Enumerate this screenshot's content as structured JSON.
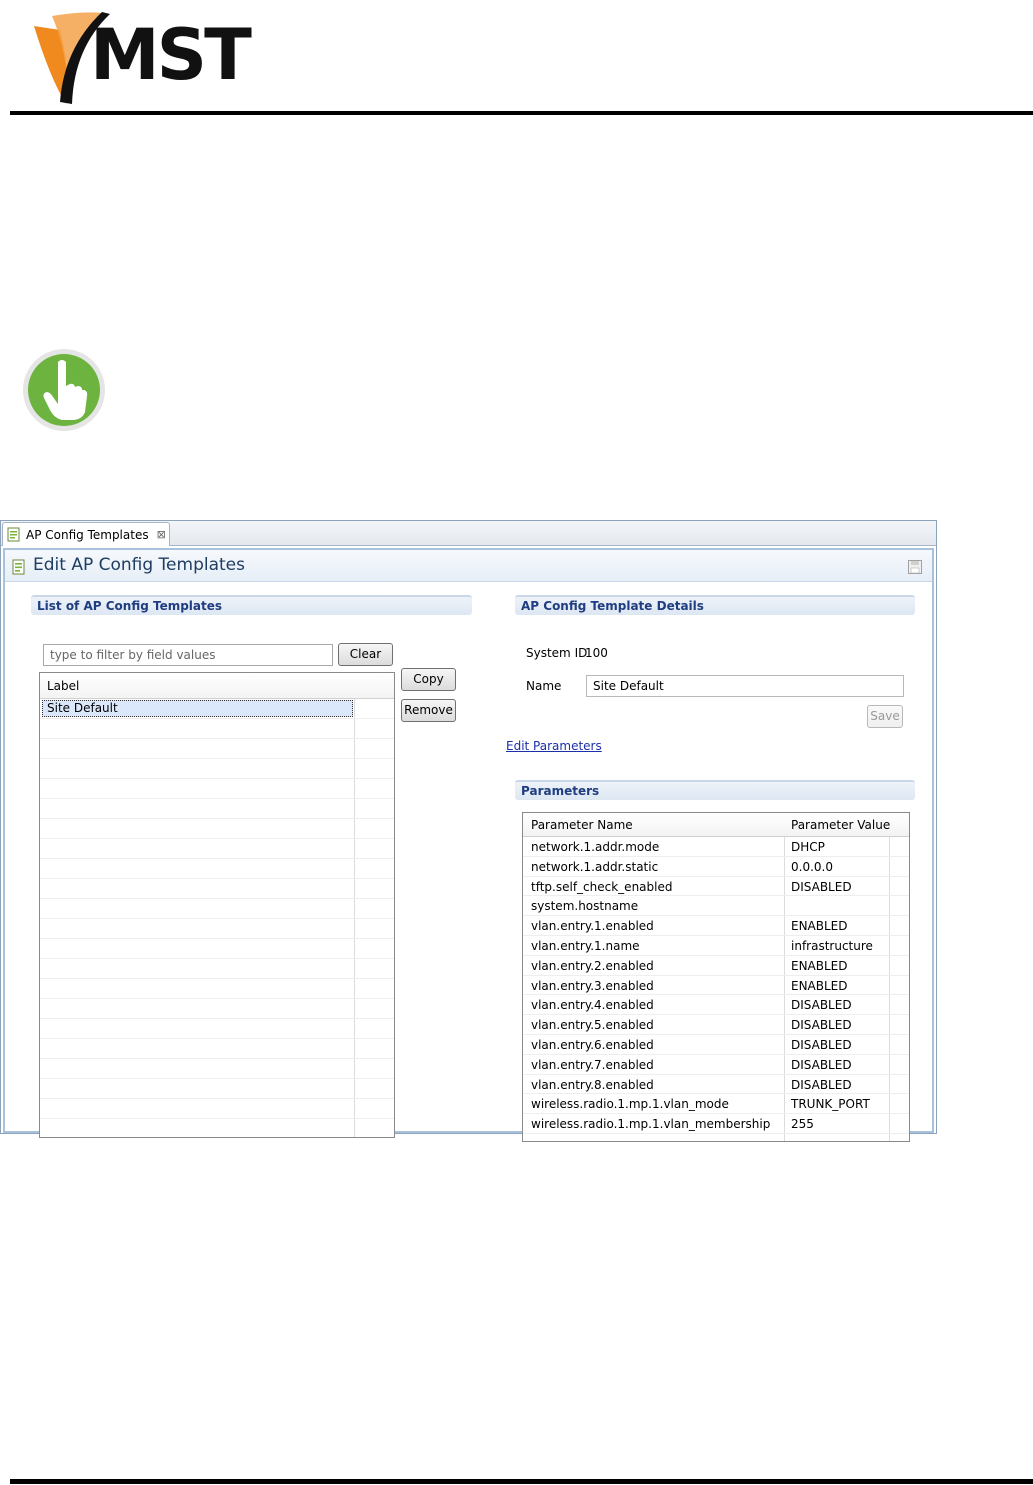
{
  "brand": {
    "logo_text": "MST",
    "accent": "#f08a1e"
  },
  "window": {
    "tab_label": "AP Config Templates",
    "tab_close_glyph": "⊠",
    "editor_title": "Edit AP Config Templates"
  },
  "list_section": {
    "title": "List of AP Config Templates",
    "filter_placeholder": "type to filter by field values",
    "clear_label": "Clear",
    "copy_label": "Copy",
    "remove_label": "Remove",
    "column_label": "Label",
    "items": [
      "Site Default"
    ]
  },
  "details_section": {
    "title": "AP Config Template Details",
    "system_id_label": "System ID",
    "system_id_value": "100",
    "name_label": "Name",
    "name_value": "Site Default",
    "save_label": "Save",
    "edit_parameters_link": "Edit Parameters"
  },
  "parameters_section": {
    "title": "Parameters",
    "columns": [
      "Parameter Name",
      "Parameter Value"
    ],
    "rows": [
      {
        "name": "network.1.addr.mode",
        "value": "DHCP"
      },
      {
        "name": "network.1.addr.static",
        "value": "0.0.0.0"
      },
      {
        "name": "tftp.self_check_enabled",
        "value": "DISABLED"
      },
      {
        "name": "system.hostname",
        "value": ""
      },
      {
        "name": "vlan.entry.1.enabled",
        "value": "ENABLED"
      },
      {
        "name": "vlan.entry.1.name",
        "value": "infrastructure"
      },
      {
        "name": "vlan.entry.2.enabled",
        "value": "ENABLED"
      },
      {
        "name": "vlan.entry.3.enabled",
        "value": "ENABLED"
      },
      {
        "name": "vlan.entry.4.enabled",
        "value": "DISABLED"
      },
      {
        "name": "vlan.entry.5.enabled",
        "value": "DISABLED"
      },
      {
        "name": "vlan.entry.6.enabled",
        "value": "DISABLED"
      },
      {
        "name": "vlan.entry.7.enabled",
        "value": "DISABLED"
      },
      {
        "name": "vlan.entry.8.enabled",
        "value": "DISABLED"
      },
      {
        "name": "wireless.radio.1.mp.1.vlan_mode",
        "value": "TRUNK_PORT"
      },
      {
        "name": "wireless.radio.1.mp.1.vlan_membership",
        "value": "255"
      }
    ]
  }
}
